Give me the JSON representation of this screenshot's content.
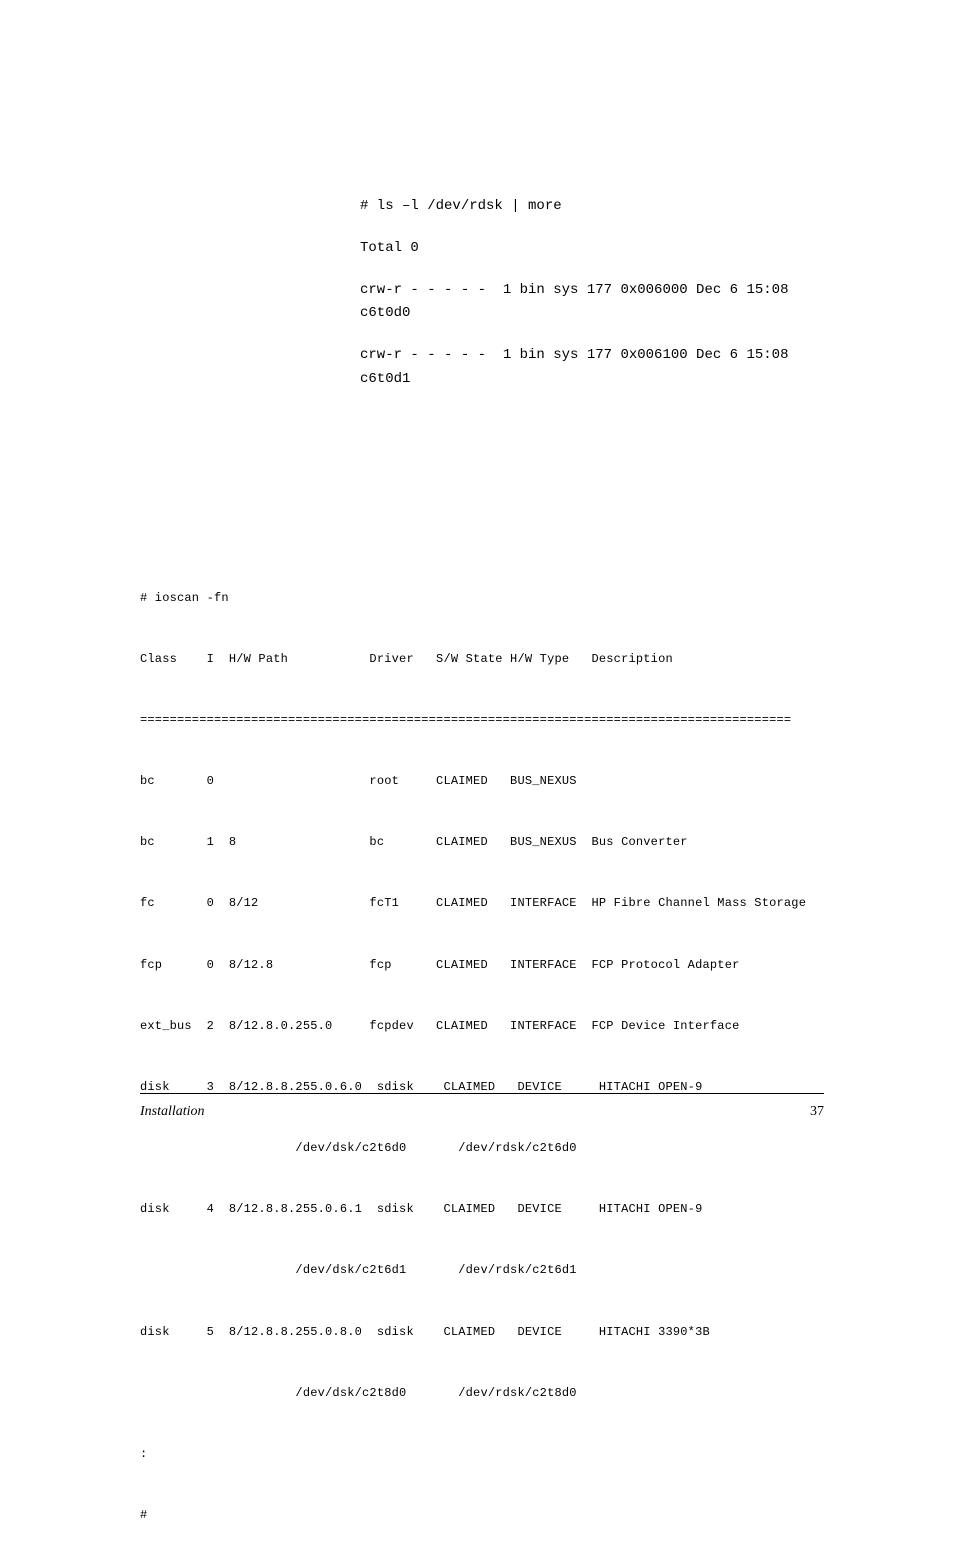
{
  "block1": {
    "lines": [
      "# ls –l /dev/rdsk | more",
      "",
      "Total 0",
      "",
      "crw-r - - - - -  1 bin sys 177 0x006000 Dec 6 15:08",
      "c6t0d0",
      "",
      "crw-r - - - - -  1 bin sys 177 0x006100 Dec 6 15:08",
      "c6t0d1"
    ]
  },
  "block2": {
    "cmd": "# ioscan -fn",
    "header": "Class    I  H/W Path           Driver   S/W State H/W Type   Description",
    "divider": "========================================================================================",
    "rows": [
      "bc       0                     root     CLAIMED   BUS_NEXUS",
      "bc       1  8                  bc       CLAIMED   BUS_NEXUS  Bus Converter",
      "fc       0  8/12               fcT1     CLAIMED   INTERFACE  HP Fibre Channel Mass Storage",
      "fcp      0  8/12.8             fcp      CLAIMED   INTERFACE  FCP Protocol Adapter",
      "ext_bus  2  8/12.8.0.255.0     fcpdev   CLAIMED   INTERFACE  FCP Device Interface",
      "disk     3  8/12.8.8.255.0.6.0  sdisk    CLAIMED   DEVICE     HITACHI OPEN-9",
      "                     /dev/dsk/c2t6d0       /dev/rdsk/c2t6d0",
      "disk     4  8/12.8.8.255.0.6.1  sdisk    CLAIMED   DEVICE     HITACHI OPEN-9",
      "                     /dev/dsk/c2t6d1       /dev/rdsk/c2t6d1",
      "disk     5  8/12.8.8.255.0.8.0  sdisk    CLAIMED   DEVICE     HITACHI 3390*3B",
      "                     /dev/dsk/c2t8d0       /dev/rdsk/c2t8d0",
      ":",
      "#"
    ]
  },
  "footer": {
    "title": "Installation",
    "page": "37"
  }
}
